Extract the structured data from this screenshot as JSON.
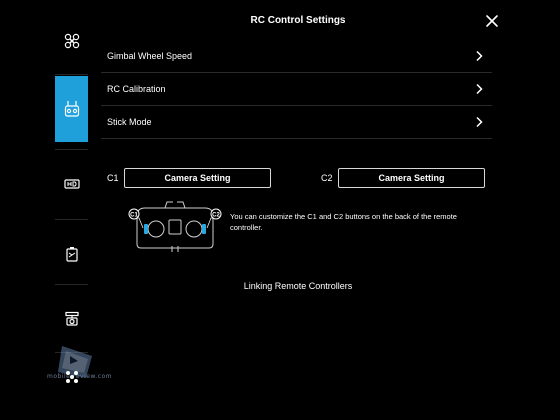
{
  "header": {
    "title": "RC Control Settings"
  },
  "icons": {
    "close": "close-icon",
    "chevron": "chevron-right-icon",
    "sidebar": [
      "drone-icon",
      "remote-controller-icon",
      "hd-transmission-icon",
      "battery-icon",
      "gimbal-icon",
      "general-settings-icon"
    ]
  },
  "colors": {
    "accent": "#1fa0db",
    "background": "#000000",
    "highlight": "#2aa8e0"
  },
  "sidebar": {
    "active_index": 1
  },
  "menu": [
    {
      "label": "Gimbal Wheel Speed"
    },
    {
      "label": "RC Calibration"
    },
    {
      "label": "Stick Mode"
    }
  ],
  "custom_buttons": {
    "c1_label": "C1",
    "c1_value": "Camera Setting",
    "c2_label": "C2",
    "c2_value": "Camera Setting",
    "diagram_c1": "C1",
    "diagram_c2": "C2",
    "info": "You can customize the C1 and C2 buttons on the back of the remote controller."
  },
  "link": {
    "label": "Linking Remote Controllers"
  },
  "watermark": {
    "text": "mobile-review.com"
  }
}
